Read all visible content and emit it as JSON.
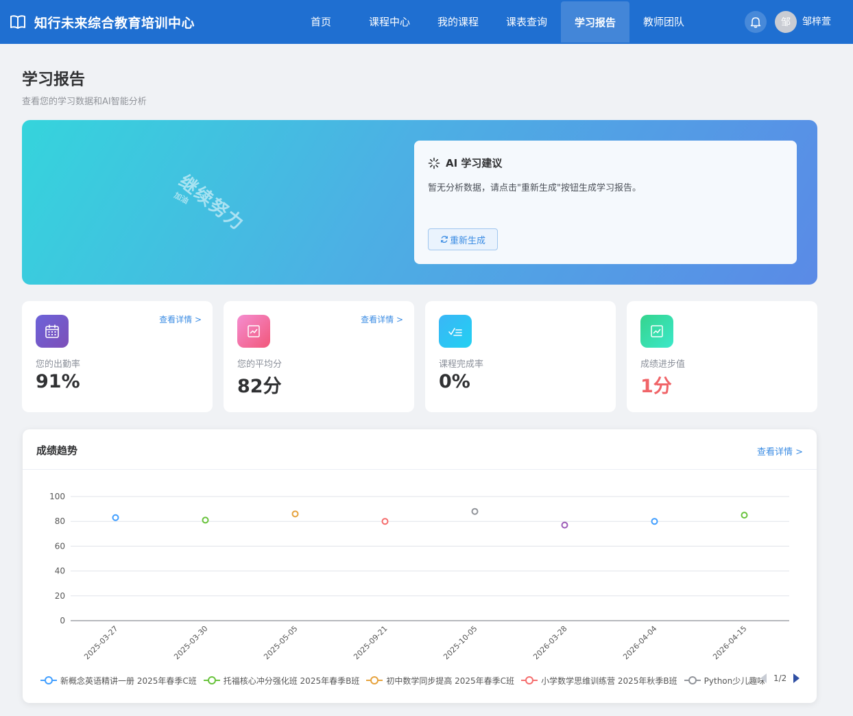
{
  "header": {
    "brand": "知行未来综合教育培训中心",
    "nav": [
      "首页",
      "课程中心",
      "我的课程",
      "课表查询",
      "学习报告",
      "教师团队"
    ],
    "active_nav": "学习报告",
    "avatar_text": "邹",
    "username": "邹梓萱"
  },
  "page": {
    "title": "学习报告",
    "subtitle": "查看您的学习数据和AI智能分析"
  },
  "banner": {
    "stamp_main": "继续努力",
    "stamp_sub": "加油",
    "ai_title": "AI 学习建议",
    "ai_text": "暂无分析数据，请点击\"重新生成\"按钮生成学习报告。",
    "regen_label": "重新生成"
  },
  "stats": [
    {
      "label": "您的出勤率",
      "value": "91%",
      "link": "查看详情 >",
      "icon": "calendar-icon",
      "gradient": [
        "#6c63d9",
        "#7d4fb8"
      ]
    },
    {
      "label": "您的平均分",
      "value": "82分",
      "link": "查看详情 >",
      "icon": "chart-up-icon",
      "gradient": [
        "#f48dd0",
        "#f2577a"
      ]
    },
    {
      "label": "课程完成率",
      "value": "0%",
      "link": "",
      "icon": "checklist-icon",
      "gradient": [
        "#3ab6f6",
        "#22d0f2"
      ]
    },
    {
      "label": "成绩进步值",
      "value": "1分",
      "link": "",
      "icon": "chart-up-icon",
      "gradient": [
        "#35d48d",
        "#3be8c9"
      ]
    }
  ],
  "chart_section": {
    "title": "成绩趋势",
    "link": "查看详情 >",
    "pager": "1/2"
  },
  "chart_data": {
    "type": "scatter",
    "title": "",
    "xlabel": "",
    "ylabel": "",
    "ylim": [
      0,
      100
    ],
    "yticks": [
      0,
      20,
      40,
      60,
      80,
      100
    ],
    "grid": true,
    "legend_position": "bottom",
    "categories": [
      "2025-03-27",
      "2025-03-30",
      "2025-05-05",
      "2025-09-21",
      "2025-10-05",
      "2026-03-28",
      "2026-04-04",
      "2026-04-15"
    ],
    "points": [
      {
        "x": "2025-03-27",
        "y": 83,
        "color": "#409eff"
      },
      {
        "x": "2025-03-30",
        "y": 81,
        "color": "#67c23a"
      },
      {
        "x": "2025-05-05",
        "y": 86,
        "color": "#e6a23c"
      },
      {
        "x": "2025-09-21",
        "y": 80,
        "color": "#f56c6c"
      },
      {
        "x": "2025-10-05",
        "y": 88,
        "color": "#909399"
      },
      {
        "x": "2026-03-28",
        "y": 77,
        "color": "#9b59b6"
      },
      {
        "x": "2026-04-04",
        "y": 80,
        "color": "#409eff"
      },
      {
        "x": "2026-04-15",
        "y": 85,
        "color": "#67c23a"
      }
    ],
    "series": [
      {
        "name": "新概念英语精讲一册 2025年春季C班",
        "color": "#409eff"
      },
      {
        "name": "托福核心冲分强化班 2025年春季B班",
        "color": "#67c23a"
      },
      {
        "name": "初中数学同步提高 2025年春季C班",
        "color": "#e6a23c"
      },
      {
        "name": "小学数学思维训练营 2025年秋季B班",
        "color": "#f56c6c"
      },
      {
        "name": "Python少儿趣味",
        "color": "#909399"
      }
    ]
  }
}
